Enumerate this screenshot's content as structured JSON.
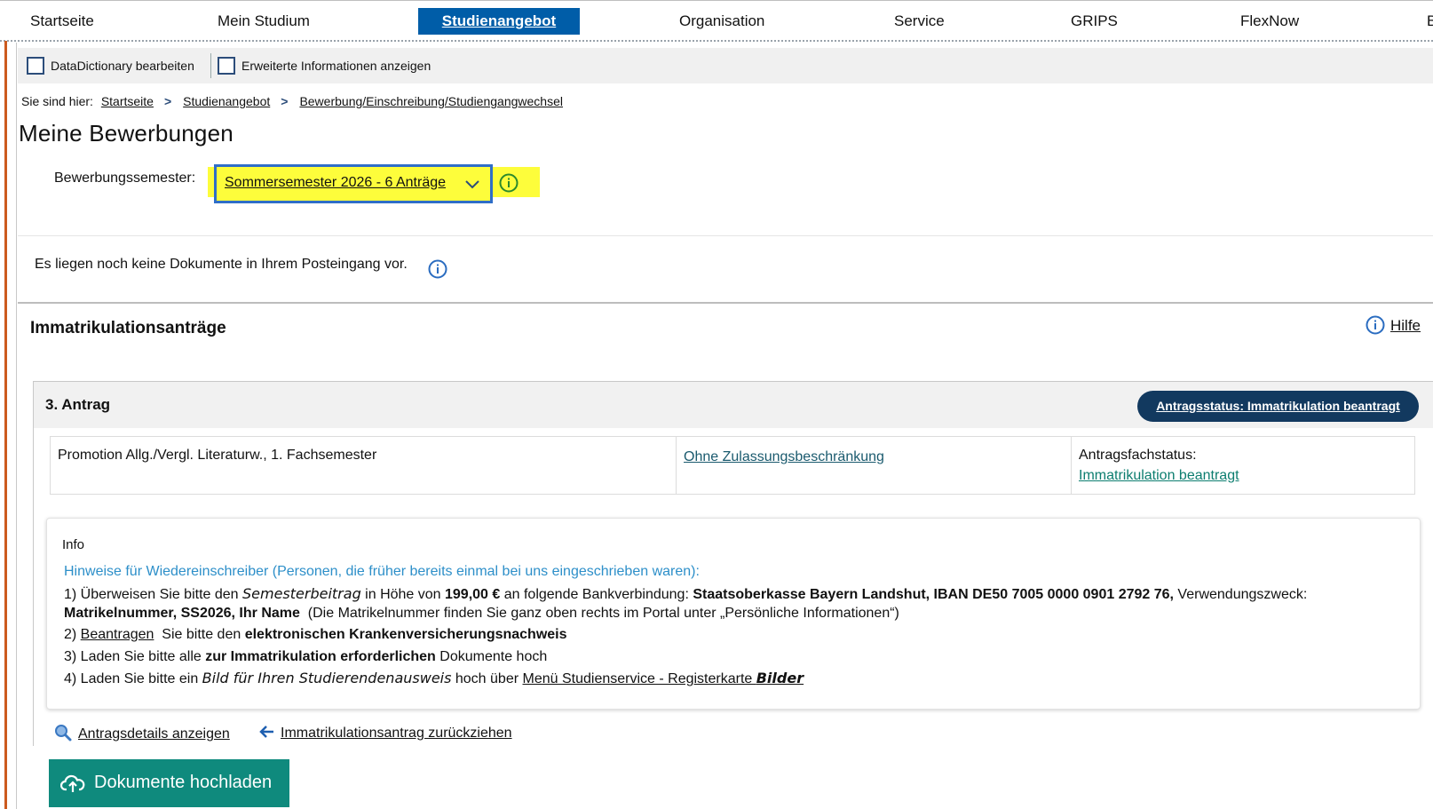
{
  "nav": {
    "items": [
      "Startseite",
      "Mein Studium",
      "Studienangebot",
      "Organisation",
      "Service",
      "GRIPS",
      "FlexNow",
      "B"
    ],
    "active": "Studienangebot"
  },
  "toolbar": {
    "datadictionary_label": "DataDictionary bearbeiten",
    "extended_info_label": "Erweiterte Informationen anzeigen"
  },
  "breadcrumb": {
    "prefix": "Sie sind hier:",
    "items": [
      "Startseite",
      "Studienangebot",
      "Bewerbung/Einschreibung/Studiengangwechsel"
    ]
  },
  "page": {
    "title": "Meine Bewerbungen"
  },
  "semester": {
    "label": "Bewerbungssemester:",
    "selected": "Sommersemester 2026 - 6 Anträge"
  },
  "inbox": {
    "message": "Es liegen noch keine Dokumente in Ihrem Posteingang vor."
  },
  "section": {
    "heading": "Immatrikulationsanträge",
    "help_label": "Hilfe"
  },
  "antrag": {
    "title": "3. Antrag",
    "status_button": "Antragsstatus: Immatrikulation beantragt",
    "study_program": "Promotion Allg./Vergl. Literaturw., 1. Fachsemester",
    "admission": "Ohne Zulassungsbeschränkung",
    "subject_status_label": "Antragsfachstatus:",
    "subject_status_value": "Immatrikulation beantragt"
  },
  "info": {
    "title": "Info",
    "heading": "Hinweise für Wiedereinschreiber (Personen, die früher bereits einmal bei uns eingeschrieben waren):",
    "line1": {
      "a": "1) Überweisen Sie bitte den ",
      "b": "Semesterbeitrag",
      "c": " in Höhe von ",
      "d": "199,00 €",
      "e": " an folgende Bankverbindung: ",
      "f": "Staatsoberkasse Bayern Landshut, IBAN DE50 7005 0000 0901 2792 76,",
      "g": " Verwendungszweck:"
    },
    "line2": {
      "a": "Matrikelnummer, SS2026, Ihr Name",
      "b": "  (Die Matrikelnummer finden Sie ganz oben rechts im Portal unter „Persönliche Informationen“)"
    },
    "line3": {
      "a": "2) ",
      "link": "Beantragen",
      "b": "  Sie bitte den ",
      "c": "elektronischen Krankenversicherungsnachweis"
    },
    "line4": {
      "a": "3) Laden Sie bitte alle ",
      "b": "zur Immatrikulation erforderlichen",
      "c": " Dokumente hoch"
    },
    "line5": {
      "a": "4) Laden Sie bitte ein ",
      "b": "Bild für Ihren Studierendenausweis",
      "c": " hoch über ",
      "link": "Menü Studienservice - Registerkarte ",
      "bold_link": "Bilder"
    }
  },
  "actions": {
    "details": "Antragsdetails anzeigen",
    "withdraw": "Immatrikulationsantrag zurückziehen",
    "upload": "Dokumente hochladen"
  },
  "colors": {
    "nav_active": "#005da8",
    "highlight": "#fdfd3b",
    "status_button": "#12395f",
    "upload_button": "#0f8a7d",
    "info_heading": "#2d8fc9",
    "left_accent": "#cc5a1e"
  }
}
